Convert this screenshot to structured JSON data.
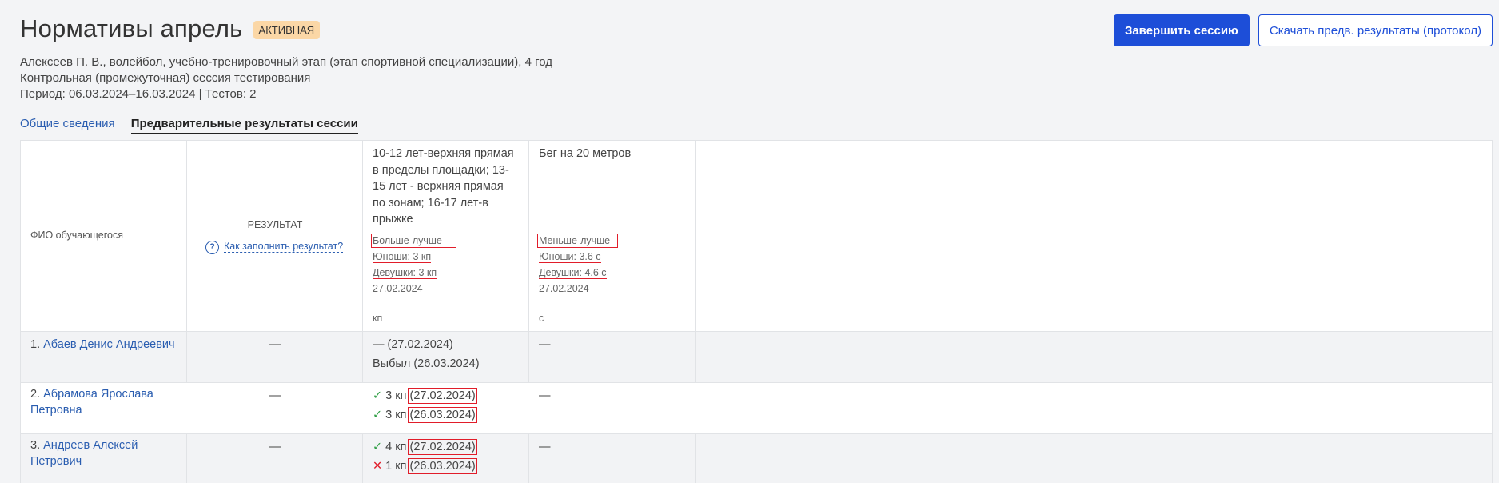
{
  "page": {
    "title": "Нормативы апрель",
    "status_badge": "АКТИВНАЯ",
    "meta_line1": "Алексеев П. В., волейбол, учебно-тренировочный этап (этап спортивной специализации), 4 год",
    "meta_line2": "Контрольная (промежуточная) сессия тестирования",
    "meta_line3": "Период: 06.03.2024–16.03.2024 | Тестов: 2"
  },
  "actions": {
    "finish_label": "Завершить сессию",
    "download_label": "Скачать предв. результаты (протокол)"
  },
  "tabs": [
    {
      "label": "Общие сведения"
    },
    {
      "label": "Предварительные результаты сессии"
    }
  ],
  "table": {
    "col_name": "ФИО обучающегося",
    "col_result": "РЕЗУЛЬТАТ",
    "how_to_fill": "Как заполнить результат?",
    "tests": [
      {
        "name_lines": [
          "10-12 лет-верхняя прямая",
          "в пределы площадки; 13-",
          "15 лет - верхняя прямая",
          "по зонам; 16-17 лет-в",
          "прыжке"
        ],
        "rule": "Больше-лучше",
        "boys": "Юноши: 3 кп",
        "girls": "Девушки: 3 кп",
        "date": "27.02.2024",
        "unit": "кп"
      },
      {
        "name_lines": [
          "Бег на 20 метров"
        ],
        "rule": "Меньше-лучше",
        "boys": "Юноши: 3.6 с",
        "girls": "Девушки: 4.6 с",
        "date": "27.02.2024",
        "unit": "с"
      }
    ],
    "rows": [
      {
        "num": "1.",
        "name_lines": [
          "Абаев Денис Андреевич"
        ],
        "result": "—",
        "t1_line1": "— (27.02.2024)",
        "t1_line2_prefix": "Выбыл",
        "t1_line2_date": "(26.03.2024)",
        "t2": "—"
      },
      {
        "num": "2.",
        "name_lines": [
          "Абрамова Ярослава",
          "Петровна"
        ],
        "result": "—",
        "t1_a_value": "3 кп",
        "t1_a_date": "(27.02.2024)",
        "t1_b_value": "3 кп",
        "t1_b_date": "(26.03.2024)",
        "t2": "—"
      },
      {
        "num": "3.",
        "name_lines": [
          "Андреев Алексей",
          "Петрович"
        ],
        "result": "—",
        "t1_a_value": "4 кп",
        "t1_a_date": "(27.02.2024)",
        "t1_b_value": "1 кп",
        "t1_b_date": "(26.03.2024)",
        "t2": "—"
      }
    ]
  },
  "icons": {
    "check": "✓",
    "cross": "✕",
    "question": "?"
  }
}
